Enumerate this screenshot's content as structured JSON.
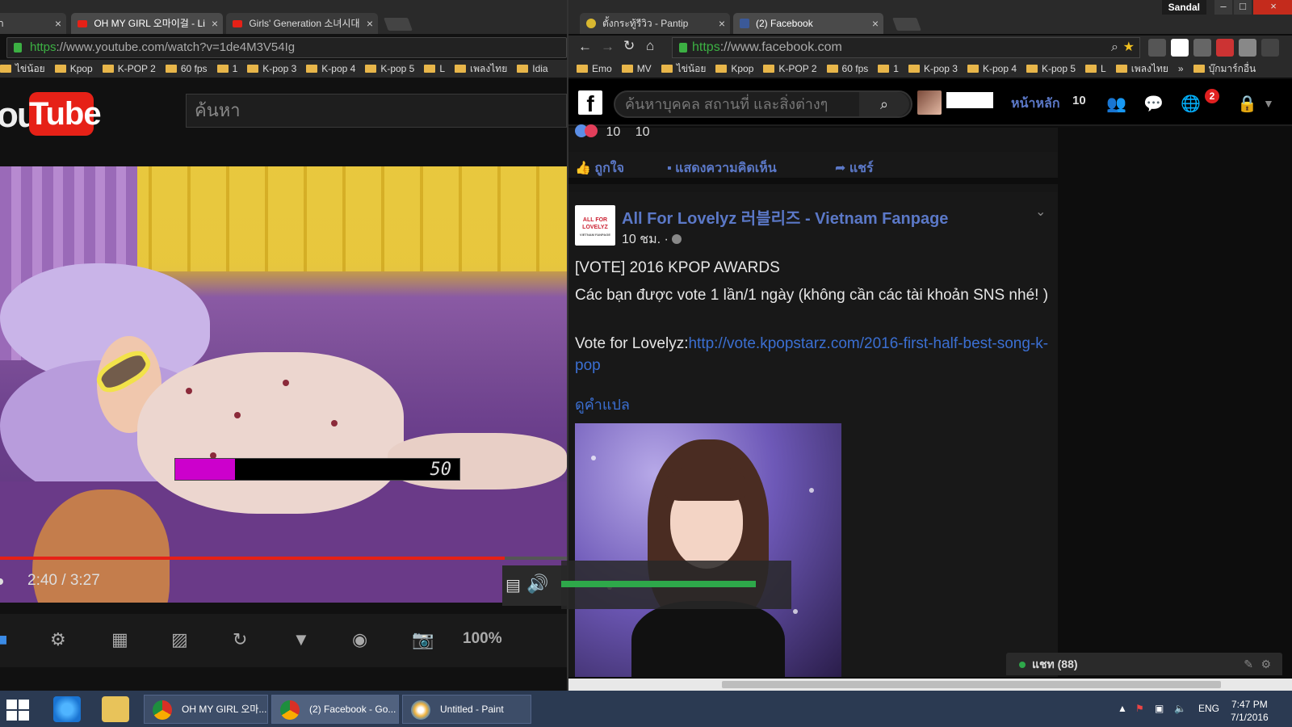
{
  "left_window": {
    "tabs": [
      {
        "label": "า"
      },
      {
        "label": "OH MY GIRL 오마이걸 - Li"
      },
      {
        "label": "Girls' Generation 소녀시대"
      }
    ],
    "url_https": "https",
    "url_rest": "://www.youtube.com/watch?v=1de4M3V54Ig",
    "bookmarks": [
      "ไข่น้อย",
      "Kpop",
      "K-POP 2",
      "60 fps",
      "1",
      "K-pop 3",
      "K-pop 4",
      "K-pop 5",
      "L",
      "เพลงไทย",
      "Idia"
    ],
    "youtube": {
      "logo_left": "ou",
      "logo_box": "Tube",
      "search_placeholder": "ค้นหา",
      "osd_value": "50",
      "osd_level_percent": 50,
      "time": "2:40 / 3:27",
      "progress_percent": 89,
      "zoom": "100%",
      "volume_percent": 90
    }
  },
  "right_window": {
    "user_label": "Sandal",
    "tabs": [
      {
        "label": "ตั้งกระทู้รีวิว - Pantip"
      },
      {
        "label": "(2) Facebook"
      }
    ],
    "url_https": "https",
    "url_rest": "://www.facebook.com",
    "bookmarks": [
      "Emo",
      "MV",
      "ไข่น้อย",
      "Kpop",
      "K-POP 2",
      "60 fps",
      "1",
      "K-pop 3",
      "K-pop 4",
      "K-pop 5",
      "L",
      "เพลงไทย",
      "»",
      "บุ๊กมาร์กอื่น"
    ],
    "facebook": {
      "search_placeholder": "ค้นหาบุคคล สถานที่ และสิ่งต่างๆ",
      "home_label": "หน้าหลัก",
      "home_count": "10",
      "notification_badge": "2",
      "reaction_count": "10",
      "comment_count": "10",
      "actions": {
        "like": "ถูกใจ",
        "comment": "แสดงความคิดเห็น",
        "share": "แชร์"
      },
      "post": {
        "avatar_text_1": "ALL FOR",
        "avatar_text_2": "LOVELYZ",
        "avatar_text_3": "VIETNAM FANPAGE",
        "page_name": "All For Lovelyz 러블리즈 - Vietnam Fanpage",
        "time": "10 ชม. ·",
        "line1": "[VOTE] 2016 KPOP AWARDS",
        "line2": "Các bạn được vote 1 lần/1 ngày (không cần các tài khoản SNS nhé! )",
        "line3_prefix": "Vote for Lovelyz:",
        "line3_link": "http://vote.kpopstarz.com/2016-first-half-best-song-k-pop",
        "translate": "ดูคำแปล"
      },
      "chat_label": "แชท (88)"
    }
  },
  "taskbar": {
    "buttons": [
      {
        "label": "OH MY GIRL 오마..."
      },
      {
        "label": "(2) Facebook - Go..."
      },
      {
        "label": "Untitled - Paint"
      }
    ],
    "language": "ENG",
    "time": "7:47 PM",
    "date": "7/1/2016"
  },
  "colors": {
    "youtube_red": "#e62117",
    "facebook_link": "#5b78c7",
    "osd_magenta": "#cc00cc",
    "volume_green": "#2ea84a"
  }
}
